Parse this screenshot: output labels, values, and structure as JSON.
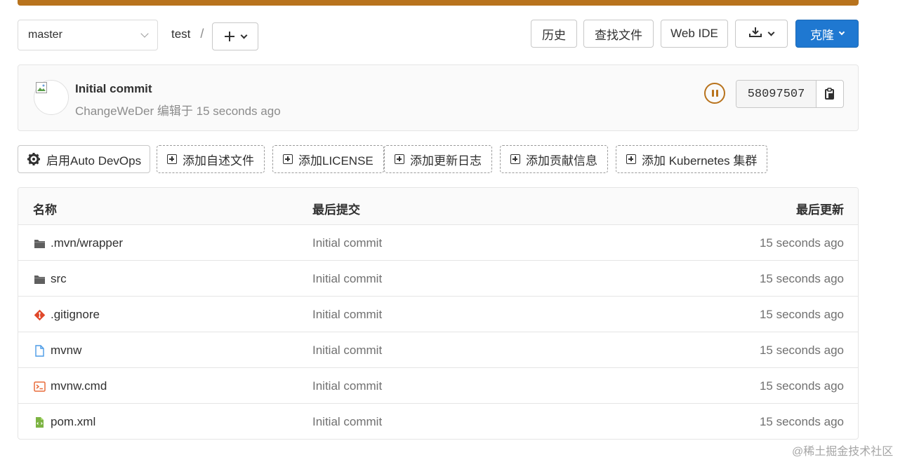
{
  "colors": {
    "accent": "#1f78d1",
    "warning": "#b8731d",
    "muted": "#707070"
  },
  "repo": {
    "branch": "master",
    "path": "test",
    "path_sep": "/"
  },
  "actions": {
    "history": "历史",
    "find_file": "查找文件",
    "web_ide": "Web IDE",
    "clone": "克隆"
  },
  "commit": {
    "title": "Initial commit",
    "author": "ChangeWeDer",
    "edited_label": "编辑于",
    "time": "15 seconds ago",
    "sha": "58097507"
  },
  "shortcuts": [
    {
      "label": "启用Auto DevOps",
      "icon": "gear-icon"
    },
    {
      "label": "添加自述文件",
      "icon": "plus-square-icon"
    },
    {
      "label": "添加LICENSE",
      "icon": "plus-square-icon"
    },
    {
      "label": "添加更新日志",
      "icon": "plus-square-icon"
    },
    {
      "label": "添加贡献信息",
      "icon": "plus-square-icon"
    },
    {
      "label": "添加 Kubernetes 集群",
      "icon": "plus-square-icon"
    }
  ],
  "table": {
    "headers": {
      "name": "名称",
      "last_commit": "最后提交",
      "last_update": "最后更新"
    },
    "rows": [
      {
        "name": ".mvn/wrapper",
        "icon": "folder-icon",
        "commit": "Initial commit",
        "updated": "15 seconds ago"
      },
      {
        "name": "src",
        "icon": "folder-icon",
        "commit": "Initial commit",
        "updated": "15 seconds ago"
      },
      {
        "name": ".gitignore",
        "icon": "git-icon",
        "commit": "Initial commit",
        "updated": "15 seconds ago"
      },
      {
        "name": "mvnw",
        "icon": "file-icon",
        "commit": "Initial commit",
        "updated": "15 seconds ago"
      },
      {
        "name": "mvnw.cmd",
        "icon": "terminal-icon",
        "commit": "Initial commit",
        "updated": "15 seconds ago"
      },
      {
        "name": "pom.xml",
        "icon": "xml-file-icon",
        "commit": "Initial commit",
        "updated": "15 seconds ago"
      }
    ]
  },
  "watermark": "@稀土掘金技术社区"
}
